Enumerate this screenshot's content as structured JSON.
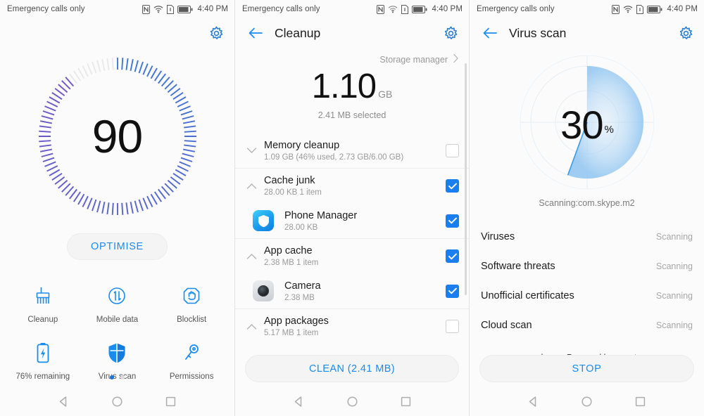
{
  "statusbar": {
    "carrier": "Emergency calls only",
    "time": "4:40 PM",
    "icons": [
      "nfc-icon",
      "wifi-icon",
      "sim-card-icon",
      "battery-icon"
    ]
  },
  "colors": {
    "accent": "#1a8cf0",
    "accent_dark": "#1b74e4",
    "checkbox_on": "#1a7ef0",
    "text_primary": "#1c1c1c",
    "text_secondary": "#9a9a9a",
    "panel_bg": "#fbfbfb"
  },
  "panel1": {
    "name": "phone-manager-home",
    "gauge": {
      "score": "90",
      "percent": 90,
      "tick_count": 96
    },
    "optimise_label": "OPTIMISE",
    "tiles": [
      {
        "icon": "broom-icon",
        "label": "Cleanup"
      },
      {
        "icon": "mobile-data-icon",
        "label": "Mobile data"
      },
      {
        "icon": "blocklist-hand-icon",
        "label": "Blocklist"
      },
      {
        "icon": "battery-icon",
        "label": "76% remaining"
      },
      {
        "icon": "shield-icon",
        "label": "Virus scan"
      },
      {
        "icon": "key-icon",
        "label": "Permissions"
      }
    ],
    "pager": {
      "count": 2,
      "active": 0
    }
  },
  "panel2": {
    "title": "Cleanup",
    "storage_manager_label": "Storage manager",
    "total_size": "1.10",
    "total_unit": "GB",
    "selected_text": "2.41 MB selected",
    "groups": [
      {
        "name": "memory-cleanup",
        "title": "Memory cleanup",
        "subtitle": "1.09 GB (46% used, 2.73 GB/6.00 GB)",
        "checked": false,
        "expanded": false,
        "children": []
      },
      {
        "name": "cache-junk",
        "title": "Cache junk",
        "subtitle": "28.00 KB  1 item",
        "checked": true,
        "expanded": true,
        "children": [
          {
            "icon": "phone-manager-app-icon",
            "title": "Phone Manager",
            "subtitle": "28.00 KB",
            "checked": true
          }
        ]
      },
      {
        "name": "app-cache",
        "title": "App cache",
        "subtitle": "2.38 MB  1 item",
        "checked": true,
        "expanded": true,
        "children": [
          {
            "icon": "camera-app-icon",
            "title": "Camera",
            "subtitle": "2.38 MB",
            "checked": true
          }
        ]
      },
      {
        "name": "app-packages",
        "title": "App packages",
        "subtitle": "5.17 MB  1 item",
        "checked": false,
        "expanded": true,
        "children": []
      }
    ],
    "clean_button_label": "CLEAN (2.41 MB)"
  },
  "panel3": {
    "title": "Virus scan",
    "progress": "30",
    "progress_unit": "%",
    "progress_value": 30,
    "scanning_text": "Scanning:com.skype.m2",
    "items": [
      {
        "name": "viruses",
        "label": "Viruses",
        "status": "Scanning"
      },
      {
        "name": "software-threats",
        "label": "Software threats",
        "status": "Scanning"
      },
      {
        "name": "unofficial-certificates",
        "label": "Unofficial certificates",
        "status": "Scanning"
      },
      {
        "name": "cloud-scan",
        "label": "Cloud scan",
        "status": "Scanning"
      }
    ],
    "powered_by": "Powered by avast",
    "stop_button_label": "STOP"
  },
  "navbar": {
    "back": "back-triangle-icon",
    "home": "home-circle-icon",
    "recents": "recents-square-icon"
  }
}
